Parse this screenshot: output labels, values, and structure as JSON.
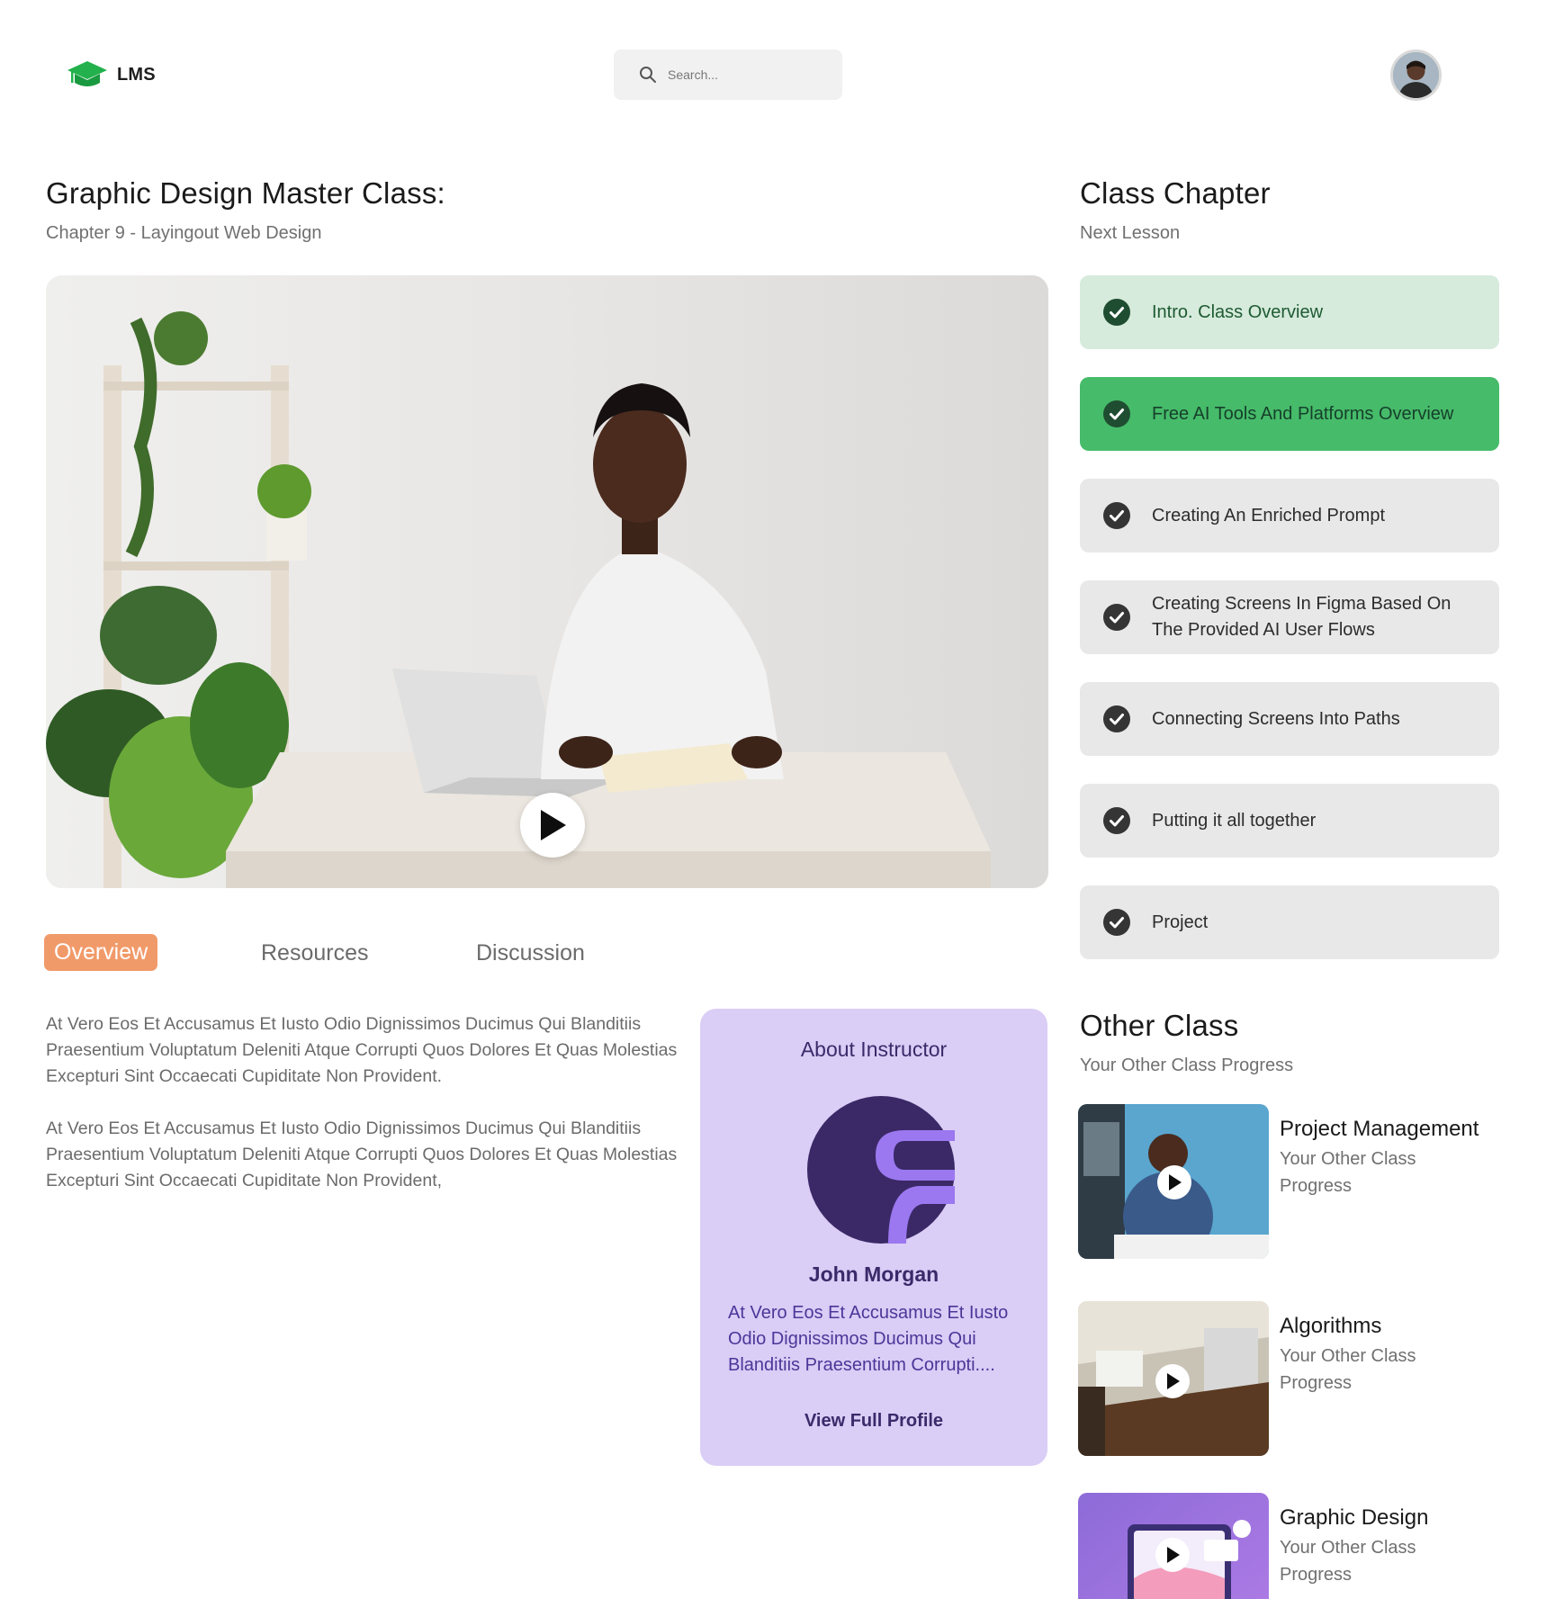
{
  "header": {
    "logo_text": "LMS",
    "search_placeholder": "Search...",
    "brand_color": "#22b14c"
  },
  "main": {
    "title": "Graphic Design Master Class:",
    "subtitle": "Chapter 9 - Layingout Web Design",
    "tabs": [
      {
        "label": "Overview",
        "active": true
      },
      {
        "label": "Resources",
        "active": false
      },
      {
        "label": "Discussion",
        "active": false
      }
    ],
    "overview_paragraphs": [
      "At Vero Eos Et Accusamus Et Iusto Odio Dignissimos Ducimus Qui Blanditiis Praesentium Voluptatum Deleniti Atque Corrupti Quos Dolores Et Quas Molestias Excepturi Sint Occaecati Cupiditate Non Provident.",
      "At Vero Eos Et Accusamus Et Iusto Odio Dignissimos Ducimus Qui Blanditiis Praesentium Voluptatum Deleniti Atque Corrupti Quos Dolores Et Quas Molestias Excepturi Sint Occaecati Cupiditate Non Provident,"
    ]
  },
  "instructor": {
    "heading": "About Instructor",
    "name": "John Morgan",
    "bio": "At Vero Eos Et Accusamus Et Iusto Odio Dignissimos Ducimus Qui Blanditiis Praesentium Corrupti....",
    "link_label": "View Full Profile",
    "card_color": "#dacdf6"
  },
  "chapters": {
    "heading": "Class Chapter",
    "subheading": "Next Lesson",
    "items": [
      {
        "label": "Intro. Class Overview",
        "state": "done"
      },
      {
        "label": "Free AI Tools And Platforms Overview",
        "state": "current"
      },
      {
        "label": "Creating An Enriched Prompt",
        "state": "default"
      },
      {
        "label": "Creating Screens In Figma Based On The Provided AI User Flows",
        "state": "default"
      },
      {
        "label": "Connecting Screens Into Paths",
        "state": "default"
      },
      {
        "label": "Putting it all together",
        "state": "default"
      },
      {
        "label": "Project",
        "state": "default"
      }
    ]
  },
  "other_classes": {
    "heading": "Other Class",
    "subheading": "Your Other Class Progress",
    "items": [
      {
        "title": "Project Management",
        "subtitle": "Your Other Class Progress"
      },
      {
        "title": "Algorithms",
        "subtitle": "Your Other Class Progress"
      },
      {
        "title": "Graphic Design",
        "subtitle": "Your Other Class Progress"
      }
    ]
  },
  "accent_color": "#f19a69",
  "current_chapter_color": "#46bb6a"
}
